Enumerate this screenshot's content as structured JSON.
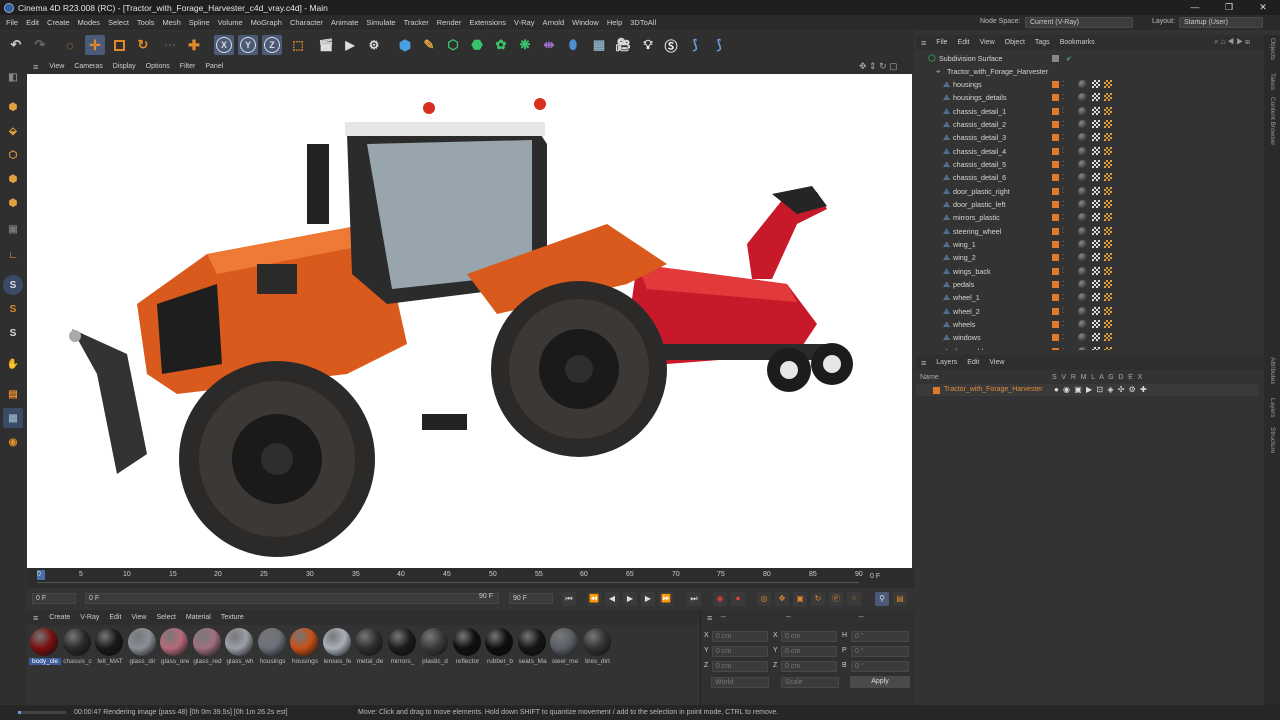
{
  "window": {
    "title": "Cinema 4D R23.008 (RC) - [Tractor_with_Forage_Harvester_c4d_vray.c4d] - Main",
    "controls": [
      "—",
      "❐",
      "✕"
    ]
  },
  "menu": [
    "File",
    "Edit",
    "Create",
    "Modes",
    "Select",
    "Tools",
    "Mesh",
    "Spline",
    "Volume",
    "MoGraph",
    "Character",
    "Animate",
    "Simulate",
    "Tracker",
    "Render",
    "Extensions",
    "V-Ray",
    "Arnold",
    "Window",
    "Help",
    "3DToAll"
  ],
  "node_space": {
    "label": "Node Space:",
    "value": "Current (V-Ray)"
  },
  "layout": {
    "label": "Layout:",
    "value": "Startup (User)"
  },
  "toolbar": {
    "axis_x": "X",
    "axis_y": "Y",
    "axis_z": "Z"
  },
  "viewport_menu": [
    "View",
    "Cameras",
    "Display",
    "Options",
    "Filter",
    "Panel"
  ],
  "timeline": {
    "ticks": [
      "0",
      "5",
      "10",
      "15",
      "20",
      "25",
      "30",
      "35",
      "40",
      "45",
      "50",
      "55",
      "60",
      "65",
      "70",
      "75",
      "80",
      "85",
      "90"
    ],
    "current_frame": "0 F",
    "start_field": "0 F",
    "range_start": "0 F",
    "range_end": "90 F",
    "end_field": "90 F"
  },
  "material_menu": [
    "Create",
    "V-Ray",
    "Edit",
    "View",
    "Select",
    "Material",
    "Texture"
  ],
  "materials": [
    {
      "name": "body_cle",
      "color": "#7a1010"
    },
    {
      "name": "chassis_c",
      "color": "#2a2a2a"
    },
    {
      "name": "felt_MAT",
      "color": "#1a1a1a"
    },
    {
      "name": "glass_dir",
      "color": "#8a8f96"
    },
    {
      "name": "glass_ore",
      "color": "#b56a7a"
    },
    {
      "name": "glass_red",
      "color": "#a07080"
    },
    {
      "name": "glass_wh",
      "color": "#9aa0a8"
    },
    {
      "name": "housings",
      "color": "#6a6f78"
    },
    {
      "name": "housings",
      "color": "#c8501a"
    },
    {
      "name": "lenses_fe",
      "color": "#a8b0b8"
    },
    {
      "name": "metal_de",
      "color": "#2e2e2e"
    },
    {
      "name": "mirrors_",
      "color": "#1c1c1c"
    },
    {
      "name": "plastic_d",
      "color": "#3a3a3a"
    },
    {
      "name": "reflector",
      "color": "#101010"
    },
    {
      "name": "rubber_b",
      "color": "#0e0e0e"
    },
    {
      "name": "seats_Ma",
      "color": "#151515"
    },
    {
      "name": "steel_me",
      "color": "#5a5f66"
    },
    {
      "name": "tires_dirt",
      "color": "#333333"
    }
  ],
  "coords": {
    "header": [
      "--",
      "--",
      "--"
    ],
    "rows": [
      {
        "a": "X",
        "av": "0 cm",
        "b": "X",
        "bv": "0 cm",
        "c": "H",
        "cv": "0 °"
      },
      {
        "a": "Y",
        "av": "0 cm",
        "b": "Y",
        "bv": "0 cm",
        "c": "P",
        "cv": "0 °"
      },
      {
        "a": "Z",
        "av": "0 cm",
        "b": "Z",
        "bv": "0 cm",
        "c": "B",
        "cv": "0 °"
      }
    ],
    "mode1": "World",
    "mode2": "Scale",
    "apply": "Apply"
  },
  "status": {
    "render": "00:00:47 Rendering image (pass 48) [0h  0m 39.5s] [0h  1m 26.2s est]",
    "hint": "Move: Click and drag to move elements. Hold down SHIFT to quantize movement / add to the selection in point mode, CTRL to remove.",
    "progress": 0.06
  },
  "object_menu": [
    "File",
    "Edit",
    "View",
    "Object",
    "Tags",
    "Bookmarks"
  ],
  "objects": {
    "root": "Subdivision Surface",
    "group": "Tractor_with_Forage_Harvester",
    "children": [
      "housings",
      "housings_details",
      "chassis_detail_1",
      "chassis_detail_2",
      "chassis_detail_3",
      "chassis_detail_4",
      "chassis_detail_5",
      "chassis_detail_6",
      "door_plastic_right",
      "door_plastic_left",
      "mirrors_plastic",
      "steering_wheel",
      "wing_1",
      "wing_2",
      "wings_back",
      "pedals",
      "wheel_1",
      "wheel_2",
      "wheels",
      "windows",
      "door_rubber"
    ]
  },
  "layers_menu": [
    "Layers",
    "Edit",
    "View"
  ],
  "layers": {
    "header_name": "Name",
    "header_flags": "S V R M L A G D E X",
    "row": "Tractor_with_Forage_Harvester"
  },
  "side_tabs": [
    "Objects",
    "Takes",
    "Content Browser",
    "Attributes",
    "Layers",
    "Structure"
  ],
  "colors": {
    "accent_orange": "#e07a2a",
    "selection_blue": "#4a5a78",
    "viewport_bg": "#ffffff"
  }
}
